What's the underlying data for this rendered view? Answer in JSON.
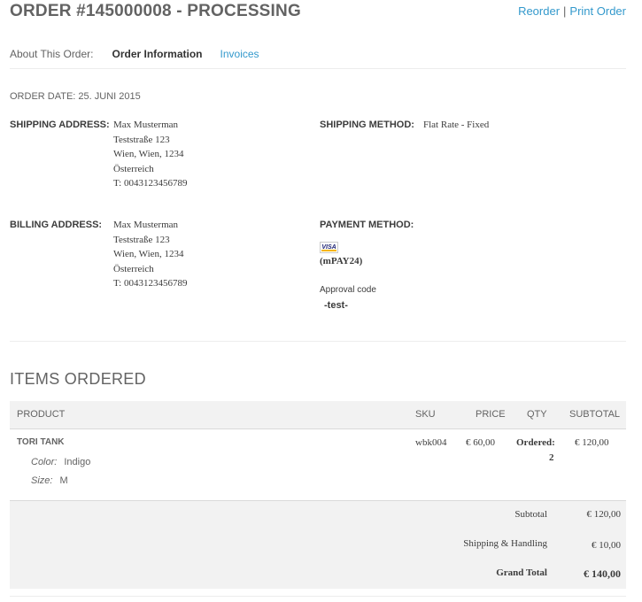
{
  "header": {
    "title": "ORDER #145000008 - PROCESSING",
    "reorder": "Reorder",
    "separator": "|",
    "print_order": "Print Order"
  },
  "tabs": {
    "about": "About This Order:",
    "order_information": "Order Information",
    "invoices": "Invoices"
  },
  "order_date": "ORDER DATE: 25. JUNI 2015",
  "shipping": {
    "label": "SHIPPING ADDRESS:",
    "lines": [
      "Max Musterman",
      "Teststraße 123",
      "Wien, Wien, 1234",
      "Österreich",
      "T: 0043123456789"
    ]
  },
  "shipping_method": {
    "label": "SHIPPING METHOD:",
    "value": "Flat Rate - Fixed"
  },
  "billing": {
    "label": "BILLING ADDRESS:",
    "lines": [
      "Max Musterman",
      "Teststraße 123",
      "Wien, Wien, 1234",
      "Österreich",
      "T: 0043123456789"
    ]
  },
  "payment": {
    "label": "PAYMENT METHOD:",
    "card_logo": "VISA",
    "name": "(mPAY24)",
    "approval_label": "Approval code",
    "approval_code": "-test-"
  },
  "items": {
    "title": "ITEMS ORDERED",
    "columns": [
      "PRODUCT",
      "SKU",
      "PRICE",
      "QTY",
      "SUBTOTAL"
    ],
    "rows": [
      {
        "name": "TORI TANK",
        "options": [
          {
            "label": "Color:",
            "value": "Indigo"
          },
          {
            "label": "Size:",
            "value": "M"
          }
        ],
        "sku": "wbk004",
        "price": "€ 60,00",
        "qty_label": "Ordered:",
        "qty": "2",
        "subtotal": "€ 120,00"
      }
    ]
  },
  "totals": {
    "subtotal_label": "Subtotal",
    "subtotal": "€ 120,00",
    "shipping_label": "Shipping & Handling",
    "shipping": "€ 10,00",
    "grand_label": "Grand Total",
    "grand": "€ 140,00"
  },
  "colors": {
    "link": "#3399cc",
    "text": "#636363",
    "table_header_bg": "#f2f2f2"
  }
}
